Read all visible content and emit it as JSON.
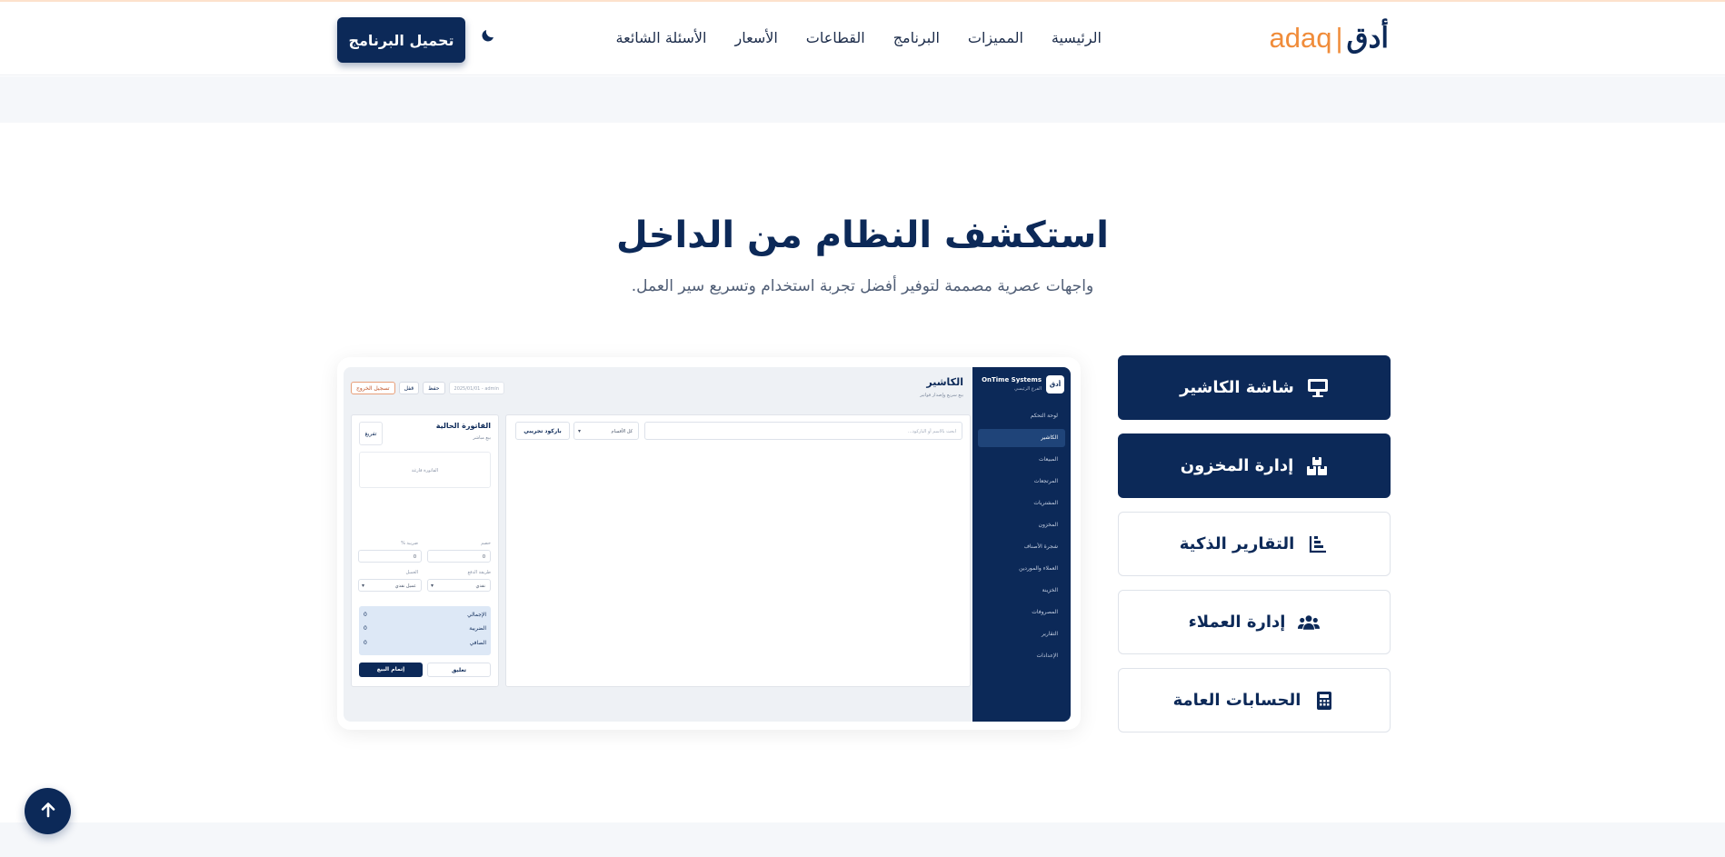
{
  "brand": {
    "arabic": "أدق",
    "separator": "|",
    "latin": "adaq",
    "accent": "#f08c3a",
    "primary": "#0c2958"
  },
  "nav": [
    {
      "label": "الرئيسية"
    },
    {
      "label": "المميزات"
    },
    {
      "label": "البرنامج"
    },
    {
      "label": "القطاعات"
    },
    {
      "label": "الأسعار"
    },
    {
      "label": "الأسئلة الشائعة"
    }
  ],
  "header": {
    "theme_icon": "moon-icon",
    "download_label": "تحميل البرنامج"
  },
  "section": {
    "title": "استكشف النظام من الداخل",
    "subtitle": "واجهات عصرية مصممة لتوفير أفضل تجربة استخدام وتسريع سير العمل."
  },
  "tabs": [
    {
      "label": "شاشة الكاشير",
      "icon": "monitor-icon",
      "active": true
    },
    {
      "label": "إدارة المخزون",
      "icon": "boxes-icon",
      "active": true
    },
    {
      "label": "التقارير الذكية",
      "icon": "chart-icon",
      "active": false
    },
    {
      "label": "إدارة العملاء",
      "icon": "users-icon",
      "active": false
    },
    {
      "label": "الحسابات العامة",
      "icon": "calculator-icon",
      "active": false
    }
  ],
  "preview": {
    "sidebar": {
      "logo_text": "أدق",
      "company": "OnTime Systems",
      "branch": "الفرع الرئيسي",
      "items": [
        "لوحة التحكم",
        "الكاشير",
        "المبيعات",
        "المرتجعات",
        "المشتريات",
        "المخزون",
        "شجرة الأصناف",
        "العملاء والموردين",
        "الخزينة",
        "المصروفات",
        "التقارير",
        "الإعدادات"
      ]
    },
    "main": {
      "title": "الكاشير",
      "subtitle": "بيع سريع وإصدار فواتير",
      "date": "2025/01/01 - admin",
      "save": "حفظ",
      "lock": "قفل",
      "logout": "تسجيل الخروج",
      "search_placeholder": "ابحث بالاسم أو الباركود...",
      "categories": "كل الأقسام",
      "barcode": "باركود تجريبي"
    },
    "invoice": {
      "title": "الفاتورة الحالية",
      "subtitle": "بيع مباشر",
      "clear": "تفريغ",
      "empty": "الفاتورة فارغة",
      "discount_label": "خصم",
      "tax_label": "ضريبة %",
      "discount_value": "0",
      "tax_value": "0",
      "pay_method_label": "طريقة الدفع",
      "customer_label": "العميل",
      "pay_method": "نقدي",
      "customer": "عميل نقدي",
      "totals": [
        {
          "k": "الإجمالي",
          "v": "0"
        },
        {
          "k": "الضريبة",
          "v": "0"
        },
        {
          "k": "الصافي",
          "v": "0"
        }
      ],
      "hold": "تعليق",
      "pay": "إتمام البيع"
    }
  },
  "scroll_top_icon": "arrow-up-icon"
}
